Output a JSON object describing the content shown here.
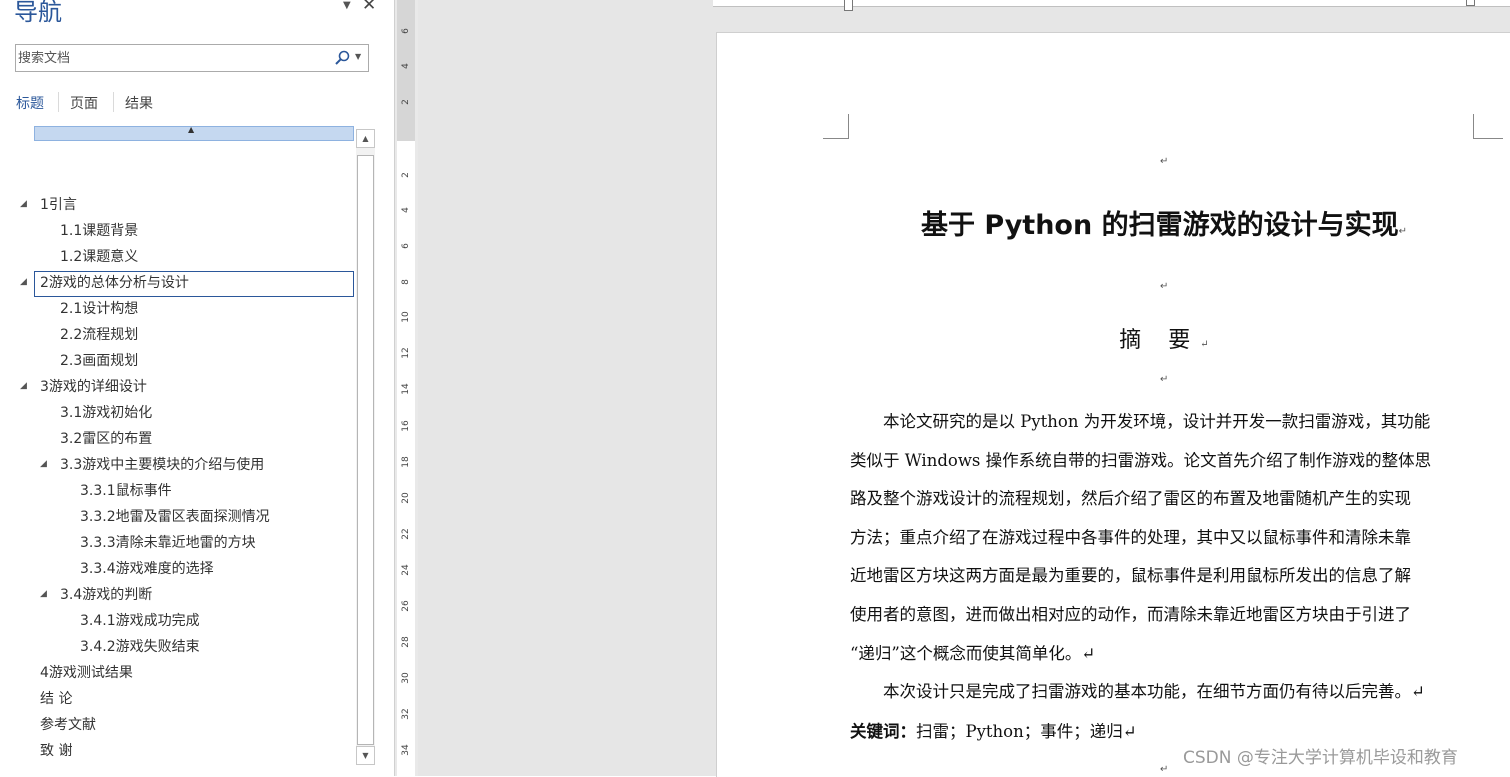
{
  "nav": {
    "title": "导航",
    "dropdown_icon": "▼",
    "close_icon": "✕",
    "search_placeholder": "搜索文档",
    "tabs": [
      "标题",
      "页面",
      "结果"
    ],
    "toc": [
      {
        "label": "1引言",
        "level": 0,
        "expanded": true
      },
      {
        "label": "1.1课题背景",
        "level": 1
      },
      {
        "label": "1.2课题意义",
        "level": 1
      },
      {
        "label": "2游戏的总体分析与设计",
        "level": 0,
        "expanded": true,
        "selected": true
      },
      {
        "label": "2.1设计构想",
        "level": 1
      },
      {
        "label": "2.2流程规划",
        "level": 1
      },
      {
        "label": "2.3画面规划",
        "level": 1
      },
      {
        "label": "3游戏的详细设计",
        "level": 0,
        "expanded": true
      },
      {
        "label": "3.1游戏初始化",
        "level": 1
      },
      {
        "label": "3.2雷区的布置",
        "level": 1
      },
      {
        "label": "3.3游戏中主要模块的介绍与使用",
        "level": 1,
        "expanded": true
      },
      {
        "label": "3.3.1鼠标事件",
        "level": 2
      },
      {
        "label": "3.3.2地雷及雷区表面探测情况",
        "level": 2
      },
      {
        "label": "3.3.3清除未靠近地雷的方块",
        "level": 2
      },
      {
        "label": "3.3.4游戏难度的选择",
        "level": 2
      },
      {
        "label": "3.4游戏的判断",
        "level": 1,
        "expanded": true
      },
      {
        "label": "3.4.1游戏成功完成",
        "level": 2
      },
      {
        "label": "3.4.2游戏失败结束",
        "level": 2
      },
      {
        "label": "4游戏测试结果",
        "level": 0
      },
      {
        "label": "结 论",
        "level": 0
      },
      {
        "label": "参考文献",
        "level": 0
      },
      {
        "label": "致 谢",
        "level": 0
      }
    ]
  },
  "ruler": {
    "numbers": [
      "6",
      "4",
      "2",
      "2",
      "4",
      "6",
      "8",
      "10",
      "12",
      "14",
      "16",
      "18",
      "20",
      "22",
      "24",
      "26",
      "28",
      "30",
      "32",
      "34"
    ]
  },
  "document": {
    "title": "基于 Python 的扫雷游戏的设计与实现",
    "abstract_heading": "摘 要",
    "paragraph_mark": "↵",
    "body_lines": [
      "　　本论文研究的是以 Python 为开发环境，设计并开发一款扫雷游戏，其功能",
      "类似于 Windows 操作系统自带的扫雷游戏。论文首先介绍了制作游戏的整体思",
      "路及整个游戏设计的流程规划，然后介绍了雷区的布置及地雷随机产生的实现",
      "方法；重点介绍了在游戏过程中各事件的处理，其中又以鼠标事件和清除未靠",
      "近地雷区方块这两方面是最为重要的，鼠标事件是利用鼠标所发出的信息了解",
      "使用者的意图，进而做出相对应的动作，而清除未靠近地雷区方块由于引进了",
      "“递归”这个概念而使其简单化。↵",
      "　　本次设计只是完成了扫雷游戏的基本功能，在细节方面仍有待以后完善。↵"
    ],
    "keywords_label": "关键词：",
    "keywords_value": "扫雷；Python；事件；递归↵"
  },
  "watermark": "CSDN @专注大学计算机毕设和教育"
}
